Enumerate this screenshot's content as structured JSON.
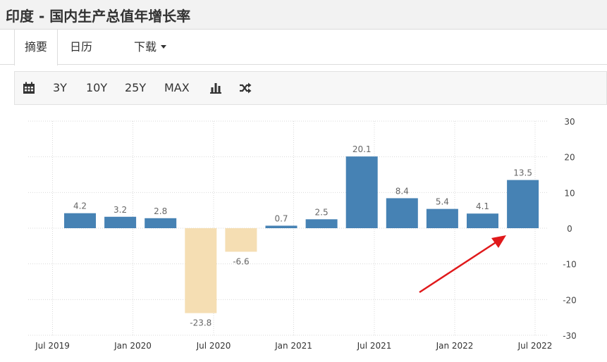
{
  "page": {
    "title": "印度 - 国内生产总值年增长率"
  },
  "tabs": [
    {
      "label": "摘要"
    },
    {
      "label": "日历"
    },
    {
      "label": "下载"
    }
  ],
  "toolbar": {
    "calendar_icon": "calendar-icon",
    "ranges": [
      "3Y",
      "10Y",
      "25Y",
      "MAX"
    ],
    "chart_type_icon": "bar-chart-icon",
    "compare_icon": "shuffle-icon"
  },
  "colors": {
    "positive_bar": "#4682b4",
    "negative_bar": "#f5deb3",
    "arrow": "#e0191b",
    "grid": "#d9d9d9"
  },
  "chart_data": {
    "type": "bar",
    "title": "",
    "xlabel": "",
    "ylabel": "",
    "ylim": [
      -30,
      30
    ],
    "yticks": [
      30,
      20,
      10,
      0,
      -10,
      -20,
      -30
    ],
    "xtick_labels": [
      "Jul 2019",
      "Jan 2020",
      "Jul 2020",
      "Jan 2021",
      "Jul 2021",
      "Jan 2022",
      "Jul 2022"
    ],
    "categories": [
      "Q3 2019",
      "Q4 2019",
      "Q1 2020",
      "Q2 2020",
      "Q3 2020",
      "Q4 2020",
      "Q1 2021",
      "Q2 2021",
      "Q3 2021",
      "Q4 2021",
      "Q1 2022",
      "Q2 2022"
    ],
    "values": [
      4.2,
      3.2,
      2.8,
      -23.8,
      -6.6,
      0.7,
      2.5,
      20.1,
      8.4,
      5.4,
      4.1,
      13.5
    ],
    "value_labels": [
      "4.2",
      "3.2",
      "2.8",
      "-23.8",
      "-6.6",
      "0.7",
      "2.5",
      "20.1",
      "8.4",
      "5.4",
      "4.1",
      "13.5"
    ],
    "grid": true,
    "y_axis_position": "right",
    "annotation": {
      "type": "arrow",
      "points_to": "Q2 2022"
    }
  }
}
